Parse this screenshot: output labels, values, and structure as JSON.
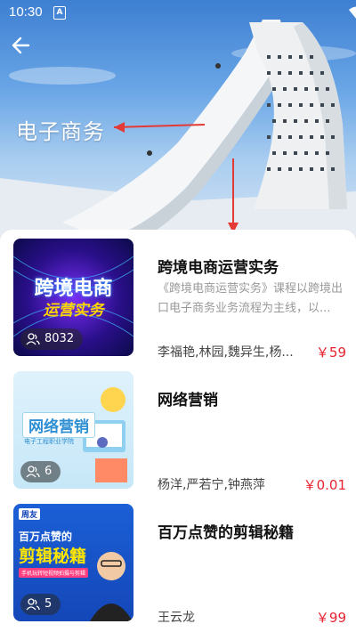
{
  "status_bar": {
    "time": "10:30",
    "notification_badge": "A",
    "icons": [
      "wifi-icon",
      "signal-icon",
      "battery-icon"
    ]
  },
  "header": {
    "back_icon": "arrow-left-icon",
    "banner_label": "电子商务"
  },
  "courses": [
    {
      "title": "跨境电商运营实务",
      "description": "《跨境电商运营实务》课程以跨境出口电子商务业务流程为主线，以...",
      "teachers": "李福艳,林园,魏异生,杨...",
      "price": "￥59",
      "enrolled": "8032",
      "thumb_text_1": "跨境电商",
      "thumb_text_2": "运营实务"
    },
    {
      "title": "网络营销",
      "description": "",
      "teachers": "杨洋,严若宁,钟燕萍",
      "price": "￥0.01",
      "enrolled": "6",
      "thumb_text_1": "网络营销",
      "thumb_text_2": "电子工程职业学院"
    },
    {
      "title": "百万点赞的剪辑秘籍",
      "description": "",
      "teachers": "王云龙",
      "price": "￥99",
      "enrolled": "5",
      "thumb_brand": "周友",
      "thumb_text_1": "百万点赞的",
      "thumb_text_2": "剪辑秘籍",
      "thumb_text_3": "手机玩转短视频拍摄与剪辑"
    }
  ],
  "colors": {
    "price": "#e8232f",
    "accent_red": "#e53935"
  }
}
